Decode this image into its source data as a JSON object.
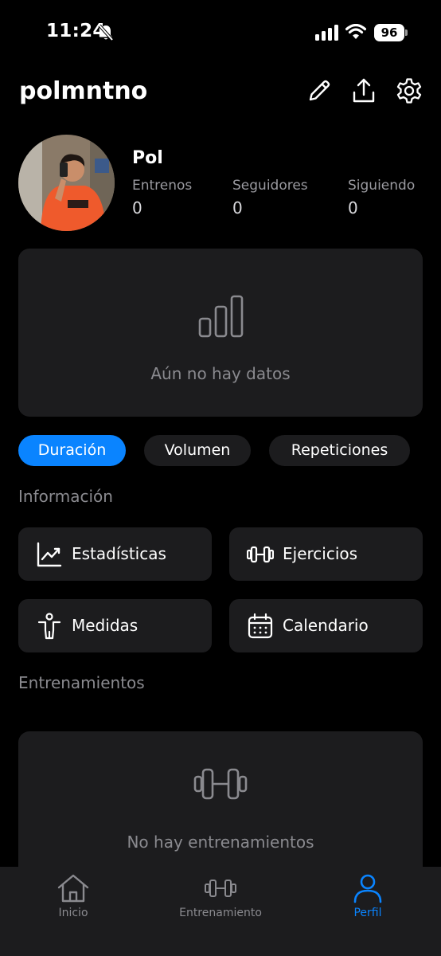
{
  "status_bar": {
    "time": "11:24",
    "battery": "96"
  },
  "header": {
    "username": "polmntno"
  },
  "profile": {
    "name": "Pol",
    "stats": [
      {
        "label": "Entrenos",
        "value": "0"
      },
      {
        "label": "Seguidores",
        "value": "0"
      },
      {
        "label": "Siguiendo",
        "value": "0"
      }
    ]
  },
  "chart_card": {
    "empty_text": "Aún no hay datos"
  },
  "chips": [
    {
      "label": "Duración",
      "active": true
    },
    {
      "label": "Volumen",
      "active": false
    },
    {
      "label": "Repeticiones",
      "active": false
    }
  ],
  "info_section": {
    "title": "Información",
    "tiles": [
      {
        "label": "Estadísticas",
        "icon": "chart-line-icon"
      },
      {
        "label": "Ejercicios",
        "icon": "dumbbell-icon"
      },
      {
        "label": "Medidas",
        "icon": "person-icon"
      },
      {
        "label": "Calendario",
        "icon": "calendar-icon"
      }
    ]
  },
  "workouts_section": {
    "title": "Entrenamientos",
    "empty_text": "No hay entrenamientos"
  },
  "tab_bar": {
    "tabs": [
      {
        "label": "Inicio",
        "icon": "home-icon",
        "active": false
      },
      {
        "label": "Entrenamiento",
        "icon": "dumbbell-icon",
        "active": false
      },
      {
        "label": "Perfil",
        "icon": "profile-icon",
        "active": true
      }
    ]
  },
  "colors": {
    "accent": "#0a84ff",
    "card": "#1c1c1e",
    "background": "#000000",
    "muted_text": "#8a8a8f"
  }
}
